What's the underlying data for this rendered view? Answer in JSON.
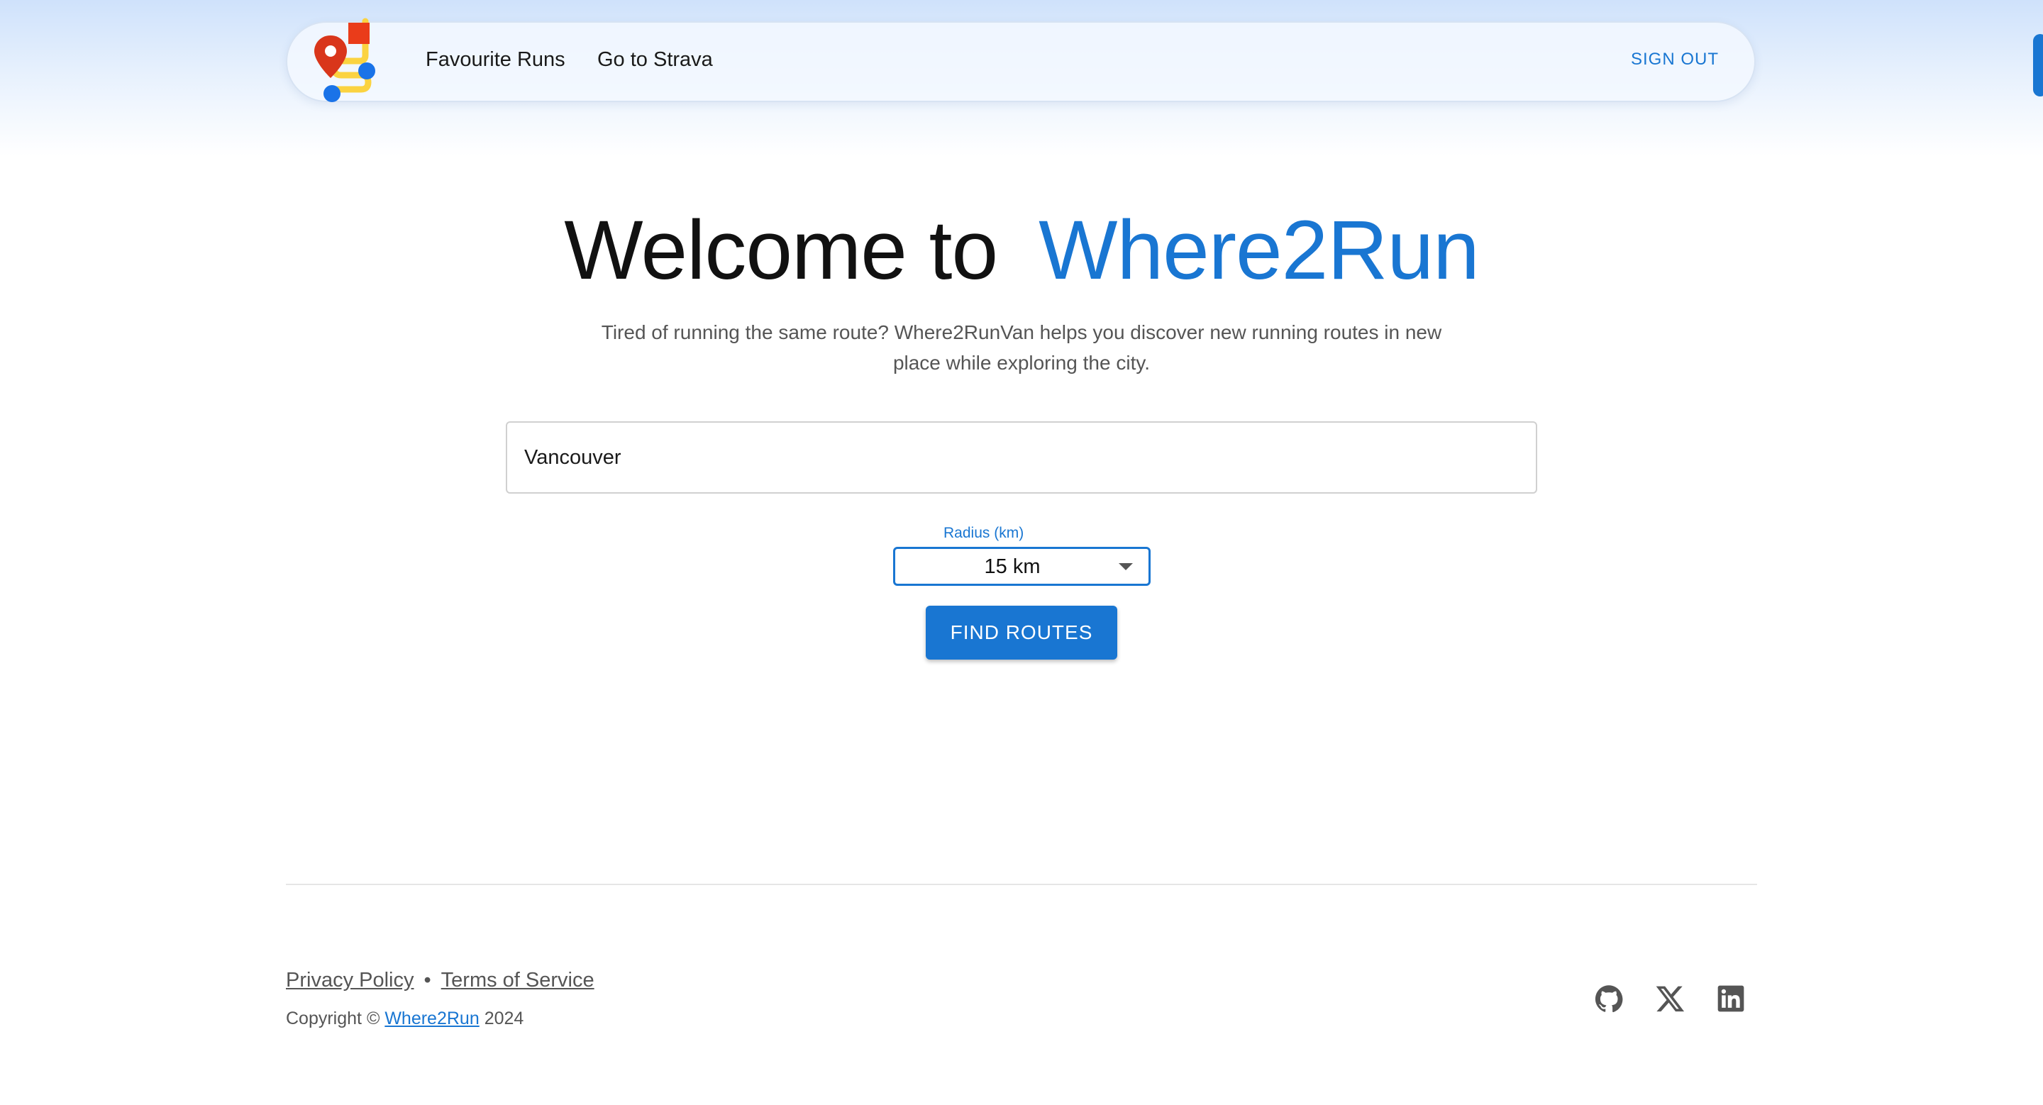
{
  "header": {
    "nav": {
      "favourite_runs": "Favourite Runs",
      "go_to_strava": "Go to Strava"
    },
    "sign_out": "SIGN OUT",
    "logo_icon": "map-route-logo-icon"
  },
  "hero": {
    "title_prefix": "Welcome to",
    "title_accent": "Where2Run",
    "subtitle": "Tired of running the same route? Where2RunVan helps you discover new running routes in new place while exploring the city."
  },
  "search": {
    "value": "Vancouver"
  },
  "radius": {
    "label": "Radius (km)",
    "selected": "15 km"
  },
  "actions": {
    "find_routes": "FIND ROUTES"
  },
  "footer": {
    "privacy": "Privacy Policy",
    "separator": "•",
    "terms": "Terms of Service",
    "copyright_prefix": "Copyright ©",
    "copyright_link": "Where2Run",
    "copyright_year": "2024",
    "social_icons": [
      "github-icon",
      "x-icon",
      "linkedin-icon"
    ]
  },
  "colors": {
    "accent": "#1976d2",
    "text_muted": "#555555",
    "header_gradient_top": "#cfe2fb"
  }
}
